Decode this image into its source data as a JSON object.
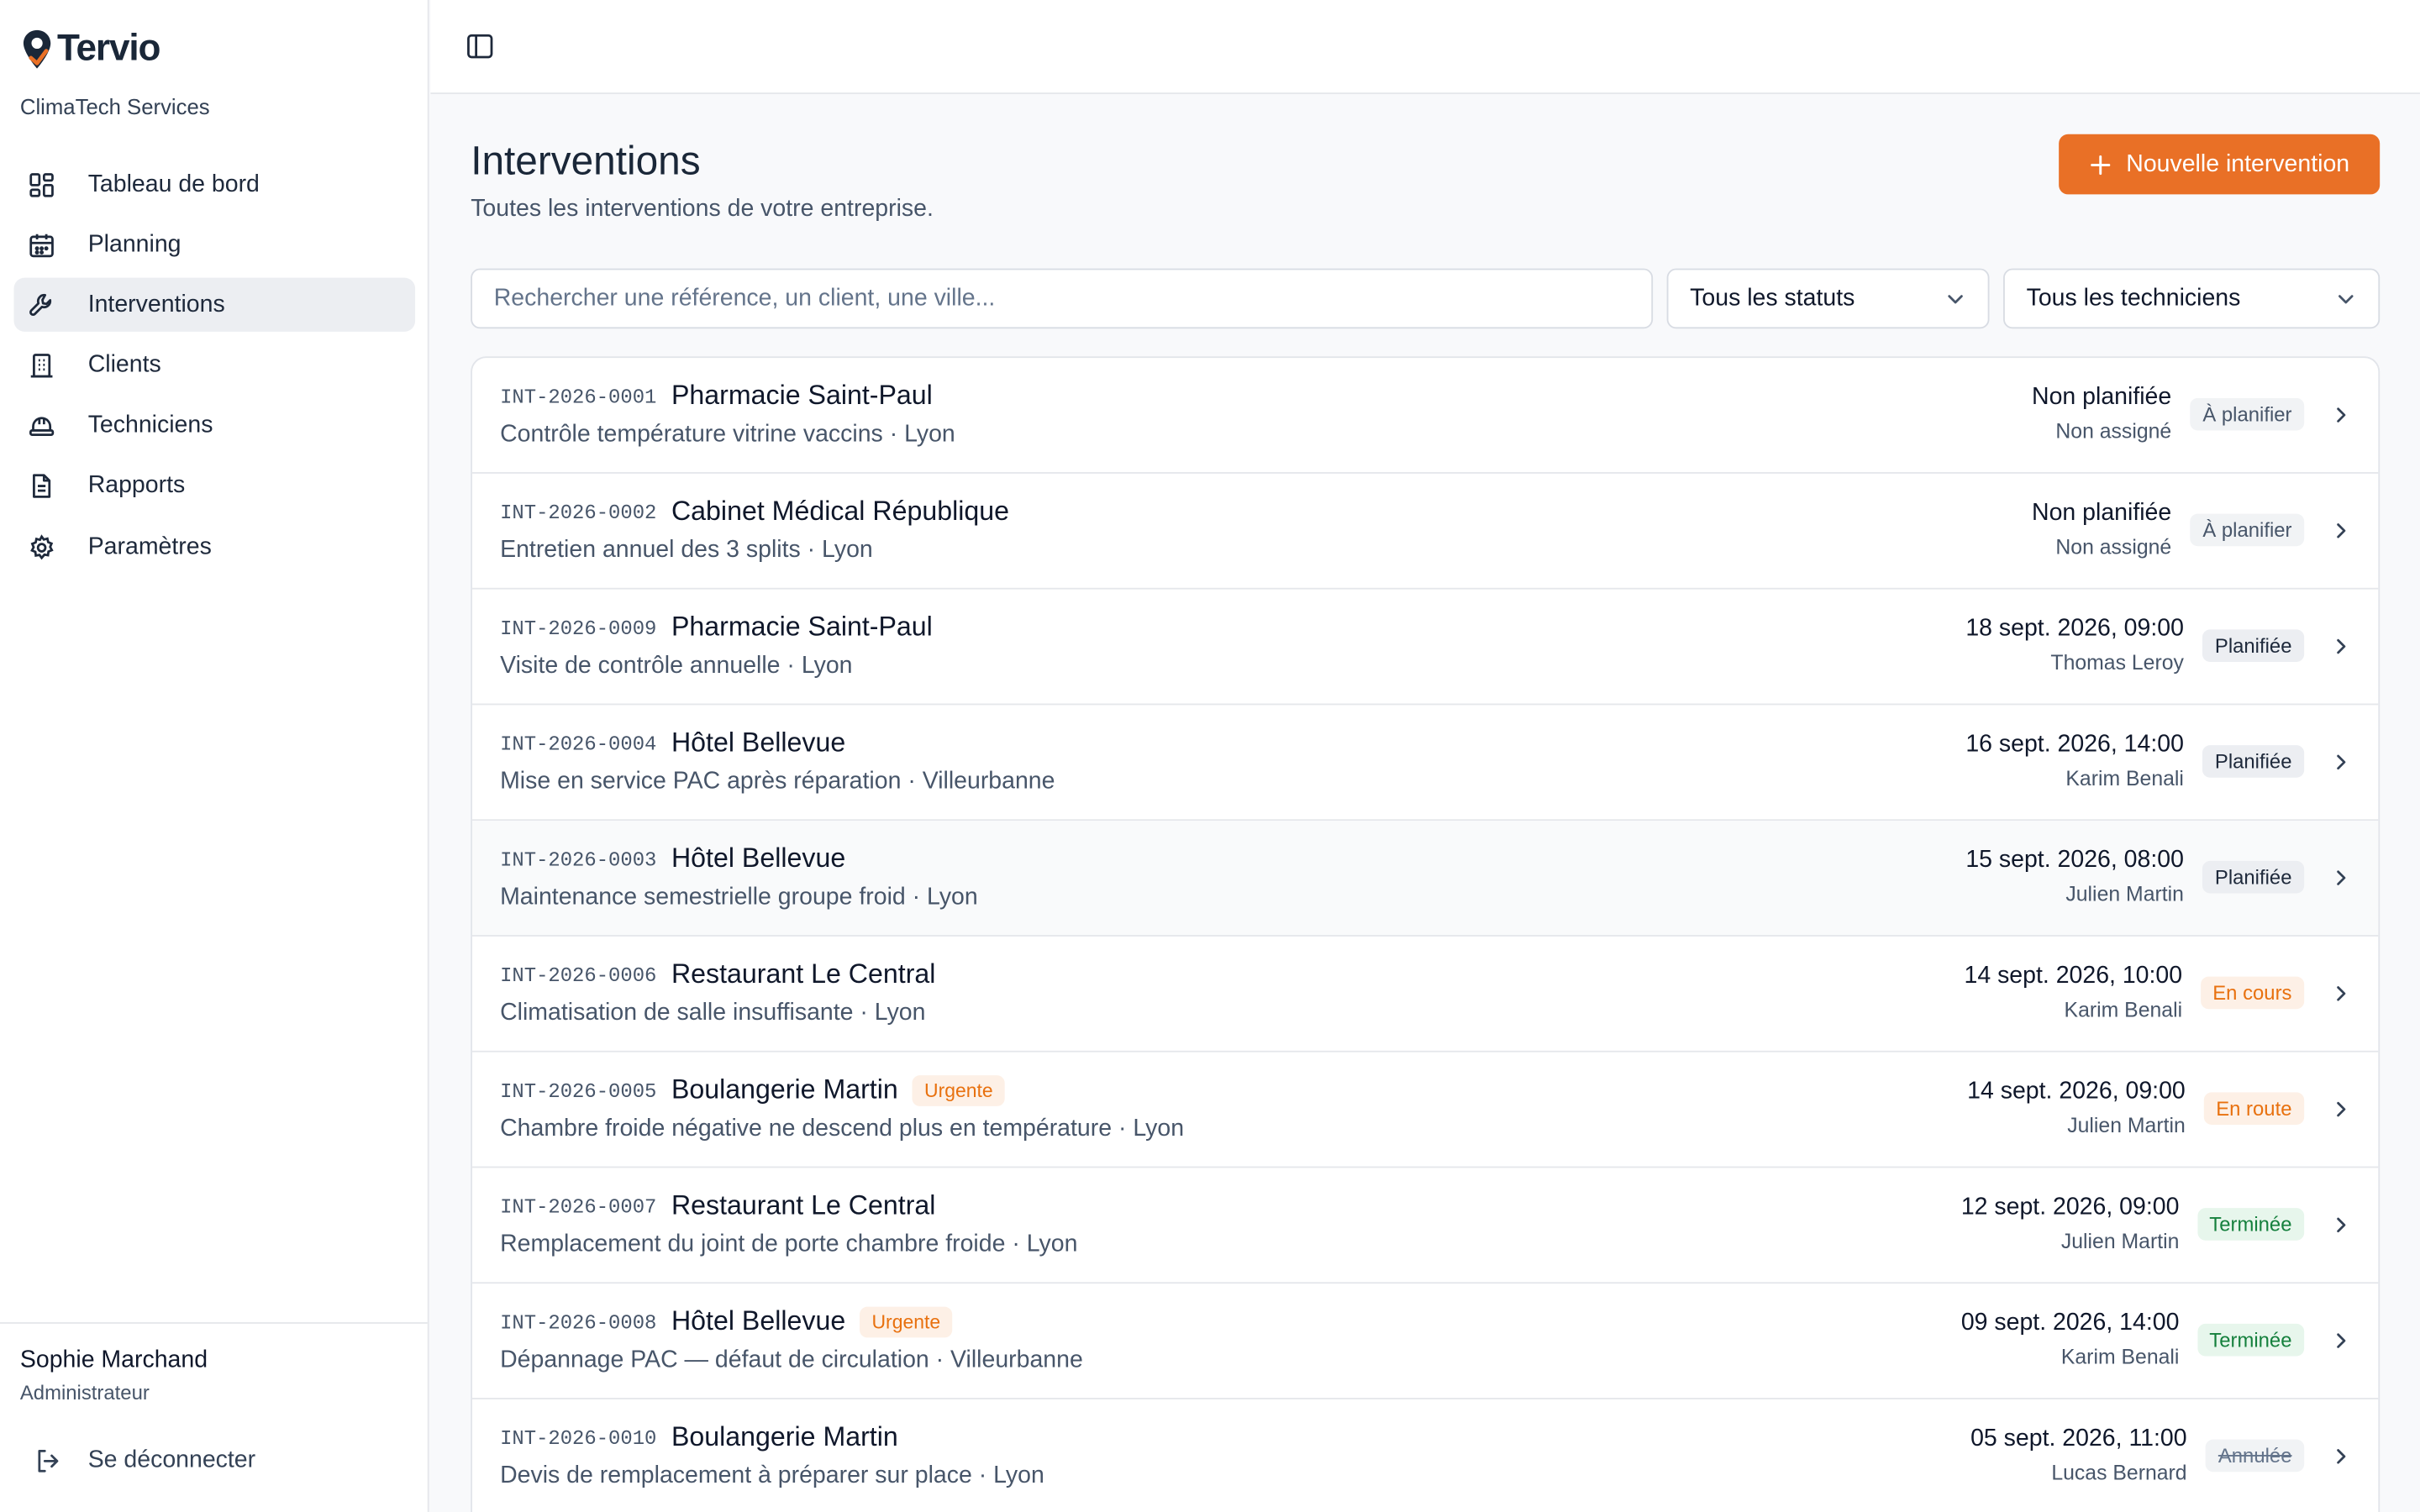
{
  "brand": {
    "name": "Tervio",
    "company": "ClimaTech Services",
    "accent": "#e97026"
  },
  "nav": [
    {
      "label": "Tableau de bord",
      "icon": "dashboard-icon",
      "active": false
    },
    {
      "label": "Planning",
      "icon": "calendar-icon",
      "active": false
    },
    {
      "label": "Interventions",
      "icon": "wrench-icon",
      "active": true
    },
    {
      "label": "Clients",
      "icon": "building-icon",
      "active": false
    },
    {
      "label": "Techniciens",
      "icon": "hard-hat-icon",
      "active": false
    },
    {
      "label": "Rapports",
      "icon": "document-icon",
      "active": false
    },
    {
      "label": "Paramètres",
      "icon": "gear-icon",
      "active": false
    }
  ],
  "user": {
    "name": "Sophie Marchand",
    "role": "Administrateur",
    "logout_label": "Se déconnecter"
  },
  "page": {
    "title": "Interventions",
    "subtitle": "Toutes les interventions de votre entreprise.",
    "new_button": "Nouvelle intervention"
  },
  "filters": {
    "search_placeholder": "Rechercher une référence, un client, une ville...",
    "status_selected": "Tous les statuts",
    "technician_selected": "Tous les techniciens"
  },
  "interventions": [
    {
      "ref": "INT-2026-0001",
      "client": "Pharmacie Saint-Paul",
      "urgent": "",
      "description": "Contrôle température vitrine vaccins · Lyon",
      "date": "Non planifiée",
      "technician": "Non assigné",
      "status": "À planifier",
      "status_key": "b-plan"
    },
    {
      "ref": "INT-2026-0002",
      "client": "Cabinet Médical République",
      "urgent": "",
      "description": "Entretien annuel des 3 splits · Lyon",
      "date": "Non planifiée",
      "technician": "Non assigné",
      "status": "À planifier",
      "status_key": "b-plan"
    },
    {
      "ref": "INT-2026-0009",
      "client": "Pharmacie Saint-Paul",
      "urgent": "",
      "description": "Visite de contrôle annuelle · Lyon",
      "date": "18 sept. 2026, 09:00",
      "technician": "Thomas Leroy",
      "status": "Planifiée",
      "status_key": "b-planifiee"
    },
    {
      "ref": "INT-2026-0004",
      "client": "Hôtel Bellevue",
      "urgent": "",
      "description": "Mise en service PAC après réparation · Villeurbanne",
      "date": "16 sept. 2026, 14:00",
      "technician": "Karim Benali",
      "status": "Planifiée",
      "status_key": "b-planifiee"
    },
    {
      "ref": "INT-2026-0003",
      "client": "Hôtel Bellevue",
      "urgent": "",
      "description": "Maintenance semestrielle groupe froid · Lyon",
      "date": "15 sept. 2026, 08:00",
      "technician": "Julien Martin",
      "status": "Planifiée",
      "status_key": "b-planifiee"
    },
    {
      "ref": "INT-2026-0006",
      "client": "Restaurant Le Central",
      "urgent": "",
      "description": "Climatisation de salle insuffisante · Lyon",
      "date": "14 sept. 2026, 10:00",
      "technician": "Karim Benali",
      "status": "En cours",
      "status_key": "b-encours"
    },
    {
      "ref": "INT-2026-0005",
      "client": "Boulangerie Martin",
      "urgent": "Urgente",
      "description": "Chambre froide négative ne descend plus en température · Lyon",
      "date": "14 sept. 2026, 09:00",
      "technician": "Julien Martin",
      "status": "En route",
      "status_key": "b-enroute"
    },
    {
      "ref": "INT-2026-0007",
      "client": "Restaurant Le Central",
      "urgent": "",
      "description": "Remplacement du joint de porte chambre froide · Lyon",
      "date": "12 sept. 2026, 09:00",
      "technician": "Julien Martin",
      "status": "Terminée",
      "status_key": "b-terminee"
    },
    {
      "ref": "INT-2026-0008",
      "client": "Hôtel Bellevue",
      "urgent": "Urgente",
      "description": "Dépannage PAC — défaut de circulation · Villeurbanne",
      "date": "09 sept. 2026, 14:00",
      "technician": "Karim Benali",
      "status": "Terminée",
      "status_key": "b-terminee"
    },
    {
      "ref": "INT-2026-0010",
      "client": "Boulangerie Martin",
      "urgent": "",
      "description": "Devis de remplacement à préparer sur place · Lyon",
      "date": "05 sept. 2026, 11:00",
      "technician": "Lucas Bernard",
      "status": "Annulée",
      "status_key": "b-annulee"
    }
  ]
}
